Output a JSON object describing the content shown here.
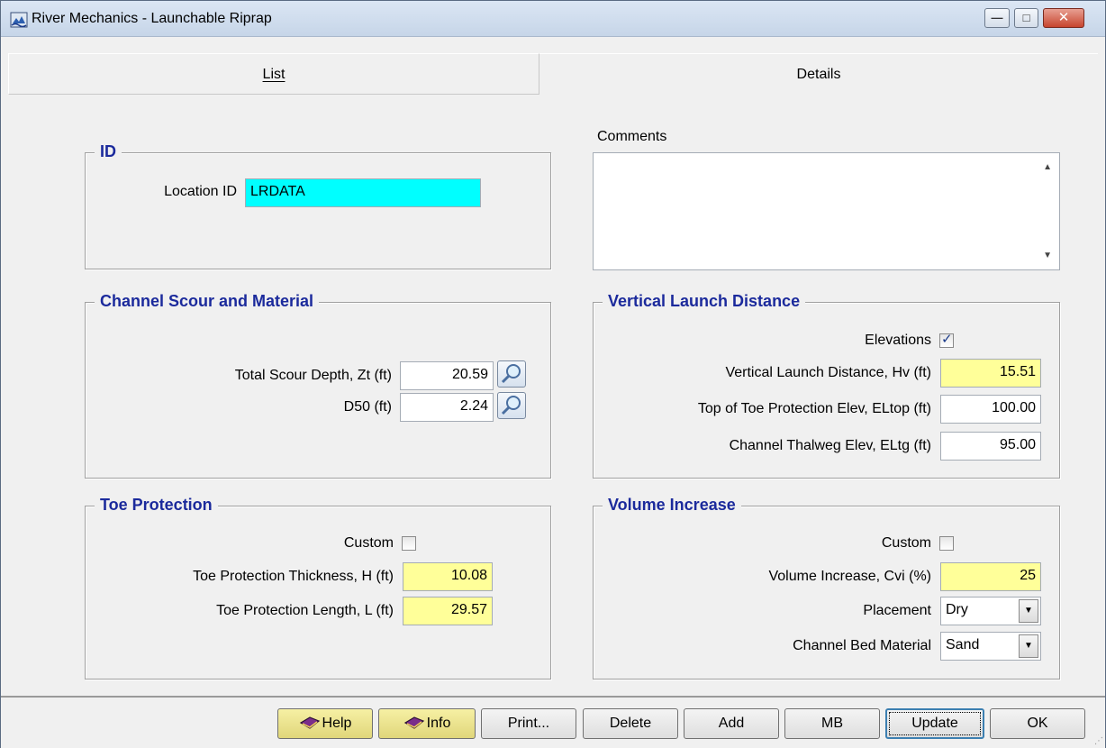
{
  "window": {
    "title": "River Mechanics - Launchable Riprap",
    "minimize": "—",
    "maximize": "□",
    "close": "✕"
  },
  "tabs": {
    "list": "List",
    "details": "Details"
  },
  "id_group": {
    "title": "ID",
    "location_id_label": "Location ID",
    "location_id_value": "LRDATA"
  },
  "comments": {
    "label": "Comments",
    "value": "",
    "scroll_up": "▲",
    "scroll_down": "▼"
  },
  "channel": {
    "title": "Channel Scour and Material",
    "scour_label": "Total Scour Depth, Zt (ft)",
    "scour_value": "20.59",
    "d50_label": "D50 (ft)",
    "d50_value": "2.24"
  },
  "vertical": {
    "title": "Vertical Launch Distance",
    "elevations_label": "Elevations",
    "elevations_checked": true,
    "hv_label": "Vertical Launch Distance, Hv (ft)",
    "hv_value": "15.51",
    "eltop_label": "Top of Toe Protection Elev, ELtop (ft)",
    "eltop_value": "100.00",
    "eltg_label": "Channel Thalweg Elev, ELtg (ft)",
    "eltg_value": "95.00"
  },
  "toe": {
    "title": "Toe Protection",
    "custom_label": "Custom",
    "custom_checked": false,
    "thickness_label": "Toe Protection Thickness, H (ft)",
    "thickness_value": "10.08",
    "length_label": "Toe Protection Length, L (ft)",
    "length_value": "29.57"
  },
  "volume": {
    "title": "Volume Increase",
    "custom_label": "Custom",
    "custom_checked": false,
    "cvi_label": "Volume Increase, Cvi (%)",
    "cvi_value": "25",
    "placement_label": "Placement",
    "placement_value": "Dry",
    "bed_label": "Channel Bed Material",
    "bed_value": "Sand"
  },
  "buttons": {
    "help": "Help",
    "info": "Info",
    "print": "Print...",
    "delete": "Delete",
    "add": "Add",
    "mb": "MB",
    "update": "Update",
    "ok": "OK"
  },
  "colors": {
    "group_title": "#1b2a9c",
    "computed_field": "#ffff99",
    "key_field": "#00ffff"
  }
}
